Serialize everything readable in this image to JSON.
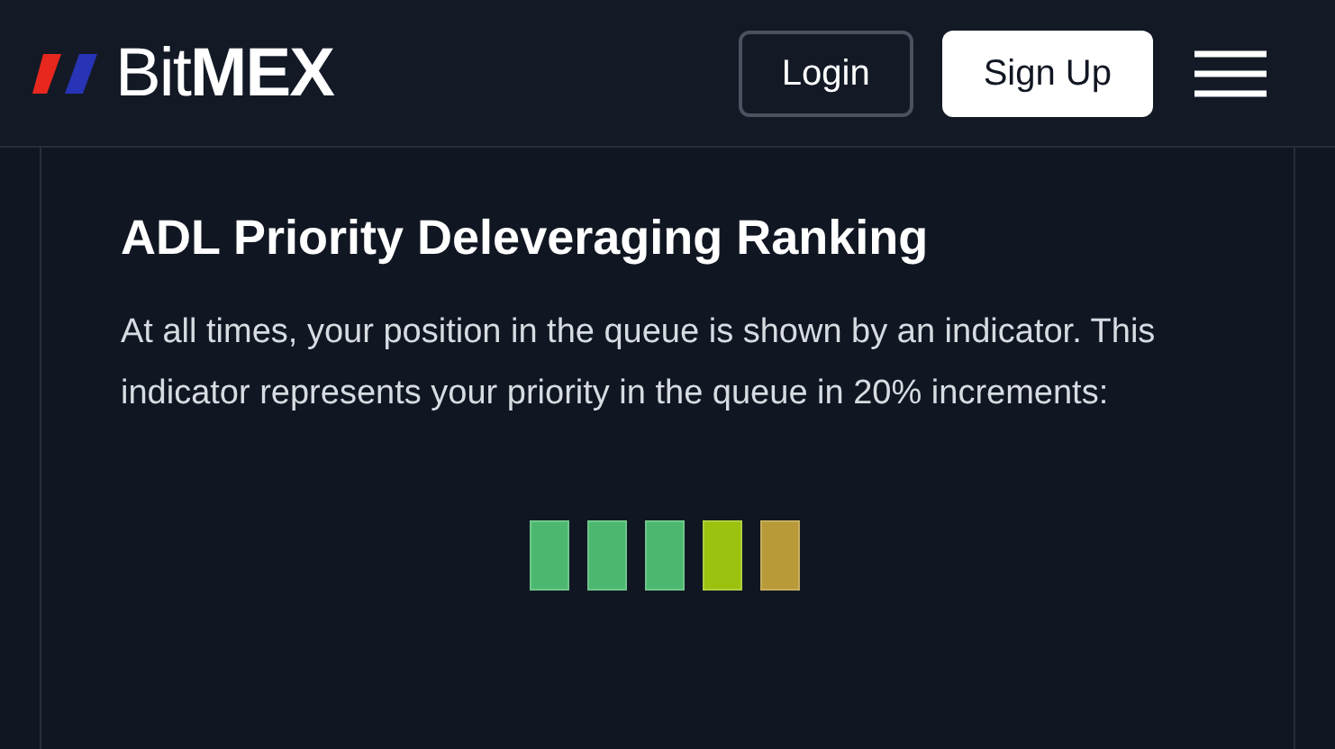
{
  "header": {
    "logo": "Bit**MEX**",
    "buttons": [
      {
        "label": "Login",
        "kind": "outline"
      },
      {
        "label": "Sign Up",
        "kind": "solid"
      }
    ]
  },
  "section": {
    "title": "ADL Priority Deleveraging Ranking",
    "text": "At all times, your position in the queue is shown by an indicator. This indicator represents your priority in the queue in 20% increments:",
    "indicator": [
      {
        "color": "#4cb86f"
      },
      {
        "color": "#4cb86f"
      },
      {
        "color": "#4cb86f"
      },
      {
        "color": "#9bc20e"
      },
      {
        "color": "#b89a38"
      }
    ]
  }
}
